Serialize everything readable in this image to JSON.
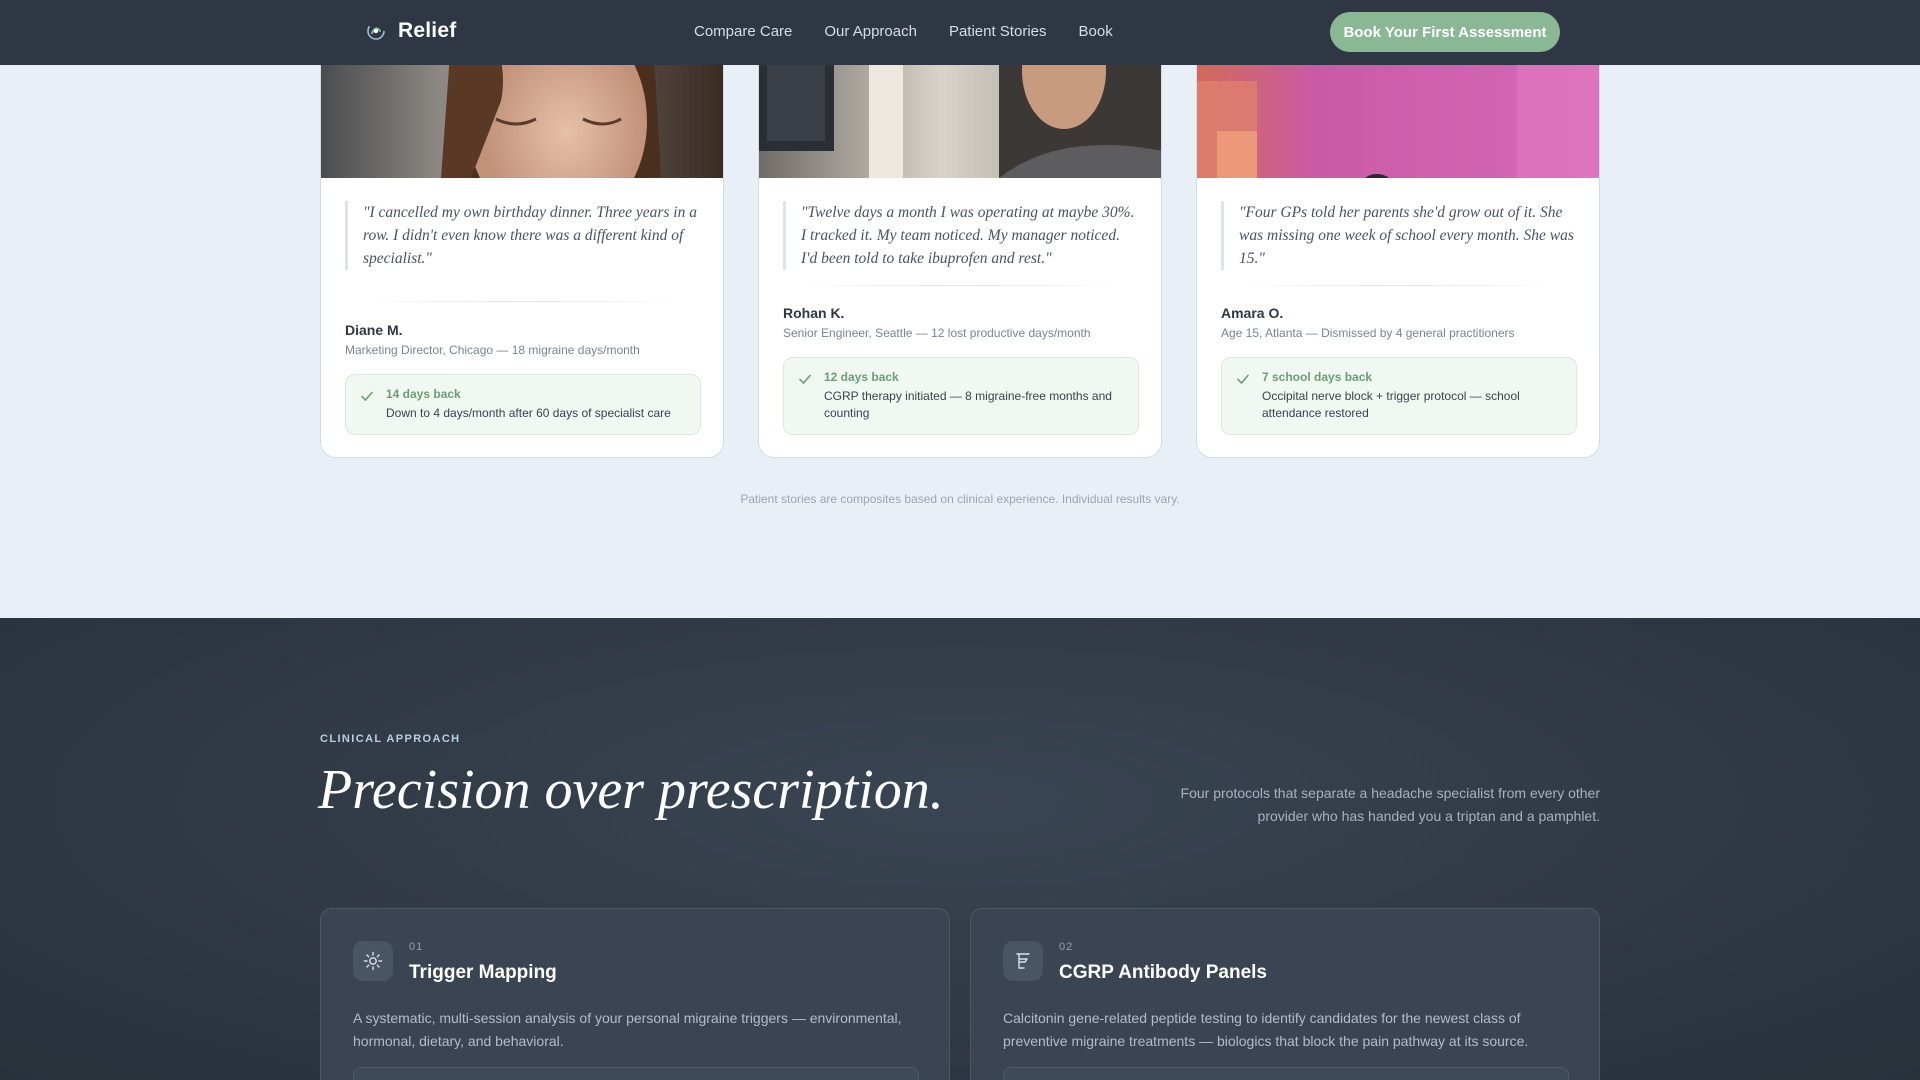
{
  "nav": {
    "brand": "Relief",
    "links": [
      "Compare Care",
      "Our Approach",
      "Patient Stories",
      "Book"
    ],
    "cta": "Book Your First Assessment"
  },
  "testimonials": [
    {
      "quote": "\"I cancelled my own birthday dinner. Three years in a row. I didn't even know there was a different kind of specialist.\"",
      "name": "Diane M.",
      "role": "Marketing Director, Chicago — 18 migraine days/month",
      "result_title": "14 days back",
      "result_desc": "Down to 4 days/month after 60 days of specialist care"
    },
    {
      "quote": "\"Twelve days a month I was operating at maybe 30%. I tracked it. My team noticed. My manager noticed. I'd been told to take ibuprofen and rest.\"",
      "name": "Rohan K.",
      "role": "Senior Engineer, Seattle — 12 lost productive days/month",
      "result_title": "12 days back",
      "result_desc": "CGRP therapy initiated — 8 migraine-free months and counting"
    },
    {
      "quote": "\"Four GPs told her parents she'd grow out of it. She was missing one week of school every month. She was 15.\"",
      "name": "Amara O.",
      "role": "Age 15, Atlanta — Dismissed by 4 general practitioners",
      "result_title": "7 school days back",
      "result_desc": "Occipital nerve block + trigger protocol — school attendance restored"
    }
  ],
  "disclaimer": "Patient stories are composites based on clinical experience. Individual results vary.",
  "approach": {
    "eyebrow": "CLINICAL APPROACH",
    "headline": "Precision over prescription.",
    "intro": "Four protocols that separate a headache specialist from every other provider who has handed you a triptan and a pamphlet.",
    "protocols": [
      {
        "num": "01",
        "title": "Trigger Mapping",
        "desc": "A systematic, multi-session analysis of your personal migraine triggers — environmental, hormonal, dietary, and behavioral.",
        "icon": "sun-icon"
      },
      {
        "num": "02",
        "title": "CGRP Antibody Panels",
        "desc": "Calcitonin gene-related peptide testing to identify candidates for the newest class of preventive migraine treatments — biologics that block the pain pathway at its source.",
        "icon": "flask-icon"
      }
    ]
  },
  "colors": {
    "accent": "#8ab894",
    "nav_bg": "#2e3743",
    "dark_section": "#2f3843",
    "result_text": "#6a9f76"
  }
}
